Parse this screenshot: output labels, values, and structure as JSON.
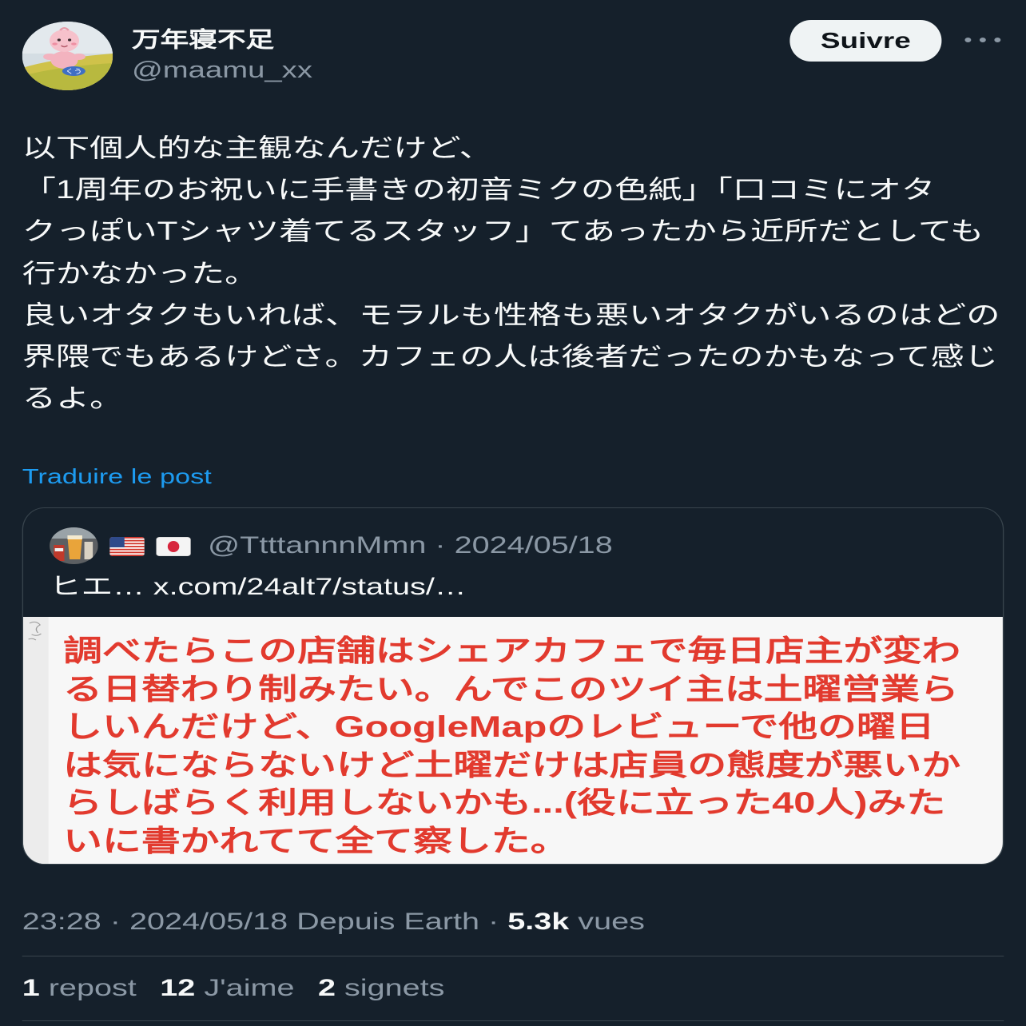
{
  "theme": {
    "background": "#15202b",
    "text_primary": "#f7f9f9",
    "text_secondary": "#8b98a5",
    "link": "#1d9bf0",
    "border": "#38444d",
    "button_background": "#eff3f4",
    "button_text": "#0f1419",
    "quoted_image_background": "#f7f7f7",
    "quoted_image_text": "#e23a2e"
  },
  "author": {
    "display_name": "万年寝不足",
    "handle": "@maamu_xx",
    "avatar_label": "くう"
  },
  "header": {
    "follow_label": "Suivre",
    "more_icon": "more-icon"
  },
  "post": {
    "lines": [
      "以下個人的な主観なんだけど、",
      "「1周年のお祝いに手書きの初音ミクの色紙」「口コミにオタ",
      "クっぽいTシャツ着てるスタッフ」てあったから近所だとしても",
      "行かなかった。",
      "良いオタクもいれば、モラルも性格も悪いオタクがいるのはどの",
      "界隈でもあるけどさ。カフェの人は後者だったのかもなって感じ",
      "るよ。"
    ],
    "translate_label": "Traduire le post"
  },
  "quoted_post": {
    "display_name_icons": [
      "us-flag-icon",
      "jp-flag-icon"
    ],
    "handle": "@TtttannnMmn",
    "separator": "·",
    "date": "2024/05/18",
    "text": "ヒエ… x.com/24alt7/status/…",
    "image_text_lines": [
      "調べたらこの店舗はシェアカフェで毎日店主が変わ",
      "る日替わり制みたい。んでこのツイ主は土曜営業ら",
      "しいんだけど、GoogleMapのレビューで他の曜日",
      "は気にならないけど土曜だけは店員の態度が悪いか",
      "らしばらく利用しないかも...(役に立った40人)みた",
      "いに書かれてて全て察した。"
    ]
  },
  "meta": {
    "time": "23:28",
    "separator": "·",
    "date": "2024/05/18",
    "location": "Depuis Earth",
    "views_count": "5.3k",
    "views_label": "vues"
  },
  "stats": [
    {
      "count": "1",
      "label": "repost"
    },
    {
      "count": "12",
      "label": "J'aime"
    },
    {
      "count": "2",
      "label": "signets"
    }
  ]
}
